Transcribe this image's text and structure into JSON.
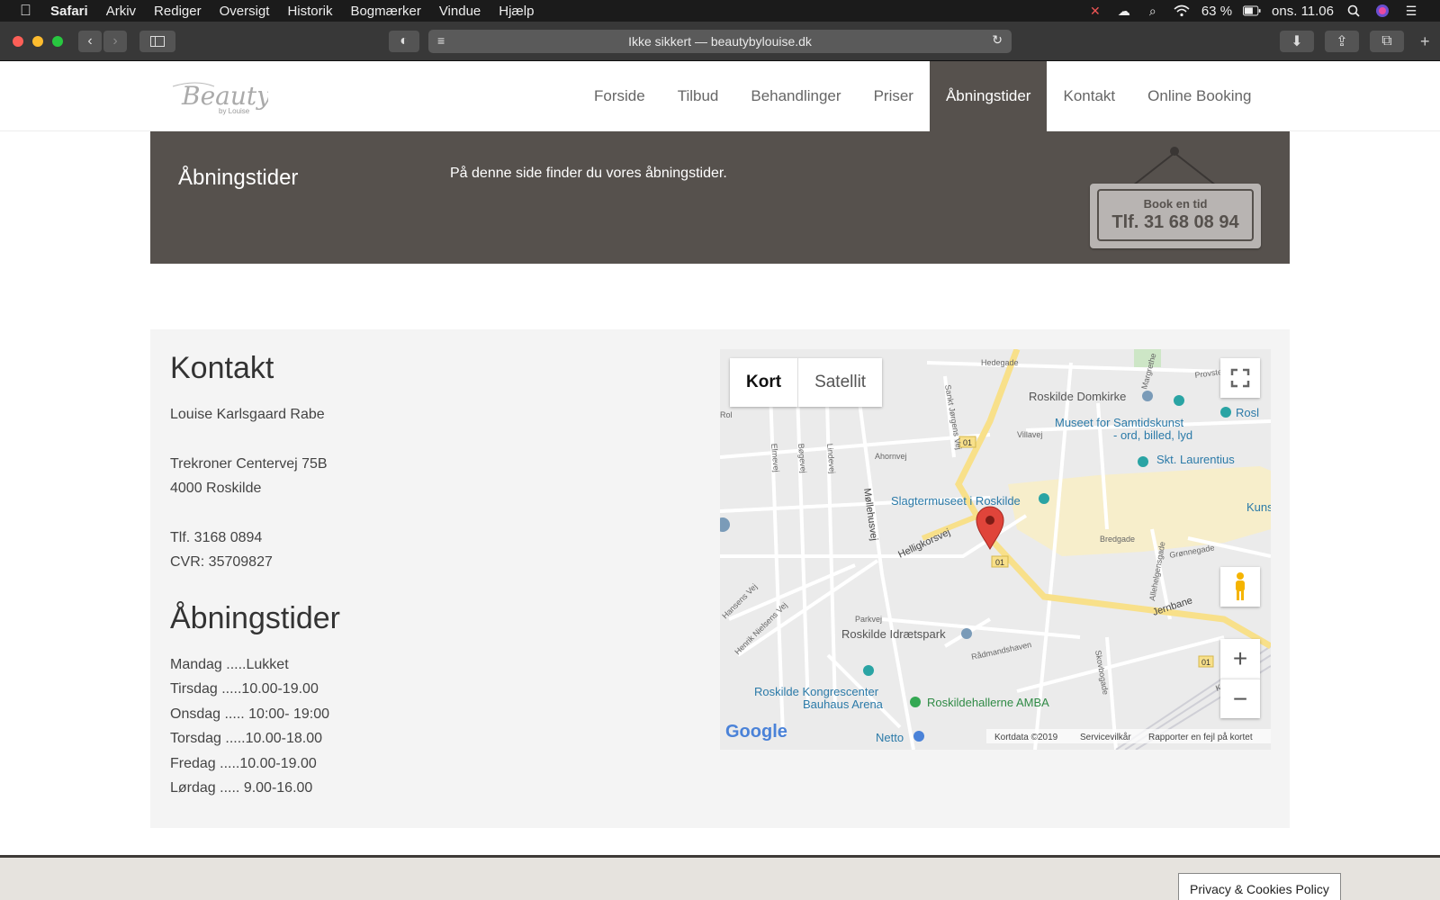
{
  "menubar": {
    "app": "Safari",
    "items": [
      "Arkiv",
      "Rediger",
      "Oversigt",
      "Historik",
      "Bogmærker",
      "Vindue",
      "Hjælp"
    ],
    "battery": "63 %",
    "clock": "ons. 11.06"
  },
  "browser": {
    "url": "Ikke sikkert — beautybylouise.dk"
  },
  "site": {
    "logo": {
      "main": "Beauty",
      "sub": "by Louise"
    },
    "nav": [
      "Forside",
      "Tilbud",
      "Behandlinger",
      "Priser",
      "Åbningstider",
      "Kontakt",
      "Online Booking"
    ],
    "active_nav": "Åbningstider",
    "banner": {
      "title": "Åbningstider",
      "text": "På denne side finder du vores åbningstider.",
      "sign_small": "Book en tid",
      "sign_big": "Tlf. 31 68 08 94"
    },
    "contact": {
      "heading": "Kontakt",
      "name": "Louise Karlsgaard Rabe",
      "street": "Trekroner Centervej 75B",
      "city": "4000 Roskilde",
      "phone": "Tlf. 3168 0894",
      "cvr": "CVR: 35709827"
    },
    "hours": {
      "heading": "Åbningstider",
      "lines": [
        "Mandag .....Lukket",
        "Tirsdag  .....10.00-19.00",
        "Onsdag ..... 10:00- 19:00",
        "Torsdag .....10.00-18.00",
        "Fredag  .....10.00-19.00",
        "Lørdag  ..... 9.00-16.00"
      ]
    },
    "map": {
      "type_buttons": [
        "Kort",
        "Satellit"
      ],
      "attribution": {
        "data": "Kortdata ©2019",
        "terms": "Servicevilkår",
        "report": "Rapporter en fejl på kortet"
      },
      "logo": "Google",
      "streets": [
        "Hedegade",
        "Provstestræde",
        "Sankt Jørgens Vej",
        "Villavej",
        "Ahornvej",
        "Elmevej",
        "Bøgevej",
        "Lindevej",
        "Møllehusvej",
        "Hellig­korsvej",
        "Bredgade",
        "Grønnegade",
        "Allehelgensgade",
        "Jernbane",
        "Rådmandshaven",
        "Skovbogade",
        "Parkvej",
        "Hansens Vej",
        "Henrik Nielsens Vej",
        "Knudsvej",
        "Margrethe",
        "Rol"
      ],
      "road_badges": [
        "01",
        "01",
        "01"
      ],
      "places": [
        "Roskilde Domkirke",
        "Museet for Samtidskunst",
        "- ord, billed, lyd",
        "Skt. Laurentius",
        "Slagtermuseet i Roskilde",
        "Roskilde Idrætspark",
        "Roskilde Kongrescenter",
        "Bauhaus Arena",
        "Roskildehallerne AMBA",
        "Netto",
        "Rosl",
        "Kuns"
      ]
    }
  },
  "footer": {
    "privacy": "Privacy & Cookies Policy"
  },
  "colors": {
    "brand": "#56514d",
    "menubar": "#1b1b1b",
    "map_road": "#f8e08a"
  }
}
